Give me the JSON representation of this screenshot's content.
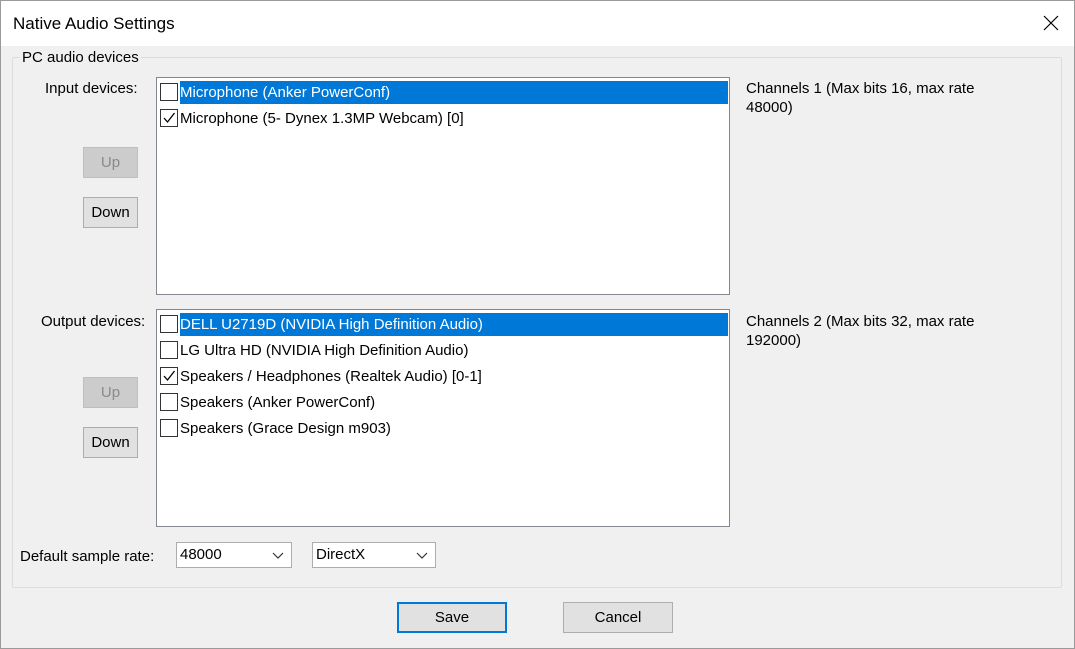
{
  "window": {
    "title": "Native Audio Settings"
  },
  "group": {
    "legend": "PC audio devices"
  },
  "input": {
    "label": "Input devices:",
    "up_label": "Up",
    "down_label": "Down",
    "items": [
      {
        "label": "Microphone (Anker PowerConf)",
        "checked": false,
        "selected": true
      },
      {
        "label": "Microphone (5- Dynex 1.3MP Webcam) [0]",
        "checked": true,
        "selected": false
      }
    ],
    "info_line1": "Channels 1 (Max bits 16, max rate",
    "info_line2": "48000)"
  },
  "output": {
    "label": "Output devices:",
    "up_label": "Up",
    "down_label": "Down",
    "items": [
      {
        "label": "DELL U2719D (NVIDIA High Definition Audio)",
        "checked": false,
        "selected": true
      },
      {
        "label": "LG Ultra HD (NVIDIA High Definition Audio)",
        "checked": false,
        "selected": false
      },
      {
        "label": "Speakers / Headphones (Realtek Audio) [0-1]",
        "checked": true,
        "selected": false
      },
      {
        "label": "Speakers (Anker PowerConf)",
        "checked": false,
        "selected": false
      },
      {
        "label": "Speakers (Grace Design m903)",
        "checked": false,
        "selected": false
      }
    ],
    "info_line1": "Channels 2 (Max bits 32, max rate",
    "info_line2": "192000)"
  },
  "sample_rate": {
    "label": "Default sample rate:",
    "value": "48000"
  },
  "driver": {
    "value": "DirectX"
  },
  "footer": {
    "save_label": "Save",
    "cancel_label": "Cancel"
  },
  "colors": {
    "selection": "#0078d7",
    "dialog_bg": "#f0f0f0",
    "primary_border": "#0078d7"
  },
  "icons": {
    "close": "close-icon",
    "check": "check-icon",
    "dropdown": "chevron-down-icon"
  }
}
